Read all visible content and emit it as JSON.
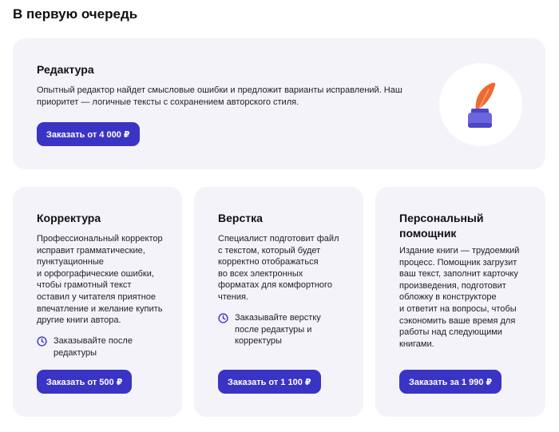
{
  "section": {
    "title": "В первую очередь"
  },
  "editing": {
    "title": "Редактура",
    "desc_lines": [
      "Опытный редактор найдет смысловые ошибки и предложит варианты исправлений. Наш",
      "приоритет — логичные тексты с сохранением авторского стиля."
    ],
    "button": "Заказать от 4 000 ₽",
    "icon": "inkwell-feather-icon"
  },
  "proofreading": {
    "title": "Корректура",
    "desc_lines": [
      "Профессиональный корректор",
      "исправит грамматические,",
      "пунктуационные",
      "и орфографические ошибки,",
      "чтобы грамотный текст",
      "оставил у читателя приятное",
      "впечатление и желание купить",
      "другие книги автора."
    ],
    "note_lines": [
      "Заказывайте после",
      "редактуры"
    ],
    "button": "Заказать от 500 ₽"
  },
  "layout": {
    "title": "Верстка",
    "desc_lines": [
      "Специалист подготовит файл",
      "с текстом, который будет",
      "корректно отображаться",
      "во всех электронных",
      "форматах для комфортного",
      "чтения."
    ],
    "note_lines": [
      "Заказывайте верстку",
      "после редактуры и",
      "корректуры"
    ],
    "button": "Заказать от 1 100 ₽"
  },
  "assistant": {
    "title_lines": [
      "Персональный",
      "помощник"
    ],
    "desc_lines": [
      "Издание книги — трудоемкий",
      "процесс. Помощник загрузит",
      "ваш текст, заполнит карточку",
      "произведения, подготовит",
      "обложку в конструкторе",
      "и ответит на вопросы, чтобы",
      "сэкономить ваше время для",
      "работы над следующими",
      "книгами."
    ],
    "button": "Заказать за 1 990 ₽"
  },
  "colors": {
    "accent": "#3a34c4",
    "card_bg": "#f3f3f9",
    "feather": "#ee6a2f",
    "ink": "#6b66de"
  }
}
